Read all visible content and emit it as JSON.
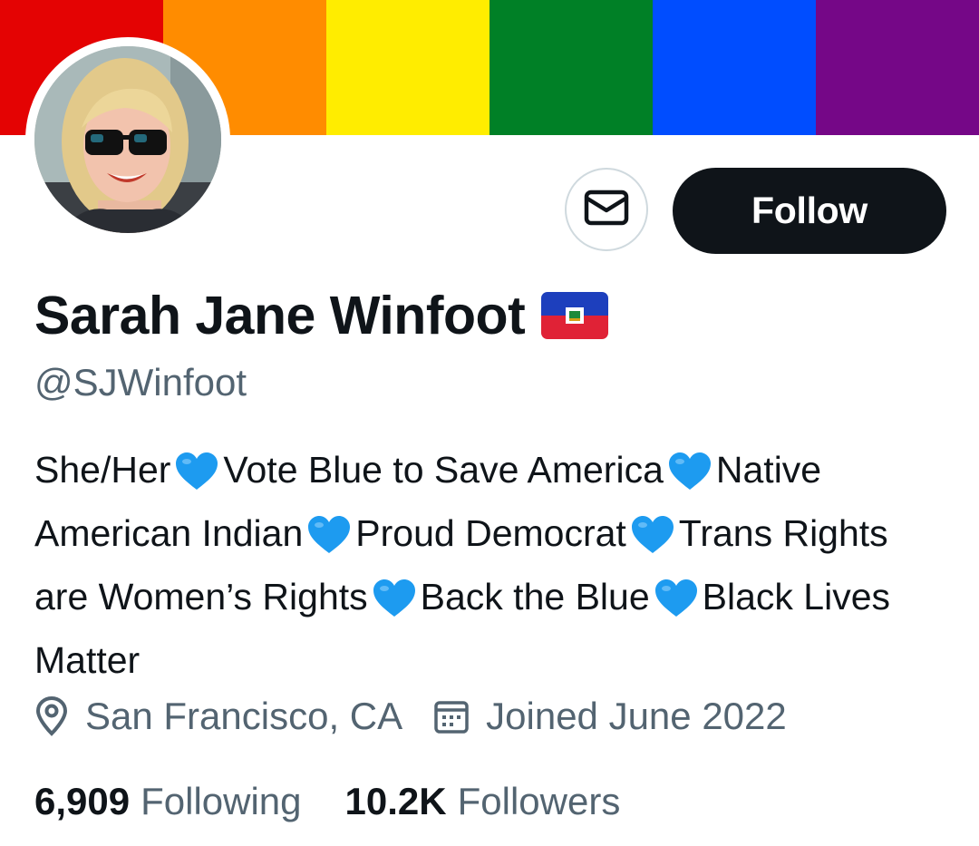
{
  "banner": {
    "stripes": [
      "#e40303",
      "#ff8c00",
      "#ffed00",
      "#008026",
      "#004dff",
      "#750787"
    ]
  },
  "profile": {
    "display_name": "Sarah Jane Winfoot",
    "name_flag_icon": "haiti-flag-emoji",
    "handle": "@SJWinfoot"
  },
  "actions": {
    "message_icon": "envelope-icon",
    "follow_label": "Follow"
  },
  "bio": {
    "segments": [
      "She/Her",
      "Vote Blue to Save America",
      "Native American Indian",
      "Proud Democrat",
      "Trans Rights are Women’s Rights",
      "Back the Blue",
      "Black Lives Matter"
    ],
    "separator_icon": "blue-heart-emoji"
  },
  "meta": {
    "location": "San Francisco, CA",
    "joined": "Joined June 2022",
    "location_icon": "location-pin-icon",
    "joined_icon": "calendar-icon"
  },
  "stats": {
    "following_count": "6,909",
    "following_label": "Following",
    "followers_count": "10.2K",
    "followers_label": "Followers"
  },
  "colors": {
    "text_primary": "#0f1419",
    "text_secondary": "#536471",
    "follow_bg": "#0f1419",
    "heart_blue": "#1d9bf0"
  }
}
